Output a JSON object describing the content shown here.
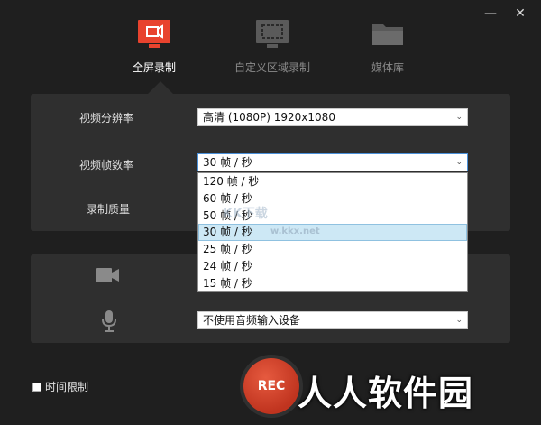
{
  "window": {
    "minimize_icon": "minimize-icon",
    "close_icon": "close-icon",
    "minimize_glyph": "—",
    "close_glyph": "✕"
  },
  "tabs": [
    {
      "label": "全屏录制",
      "icon": "fullscreen-record-icon",
      "active": true
    },
    {
      "label": "自定义区域录制",
      "icon": "region-record-icon",
      "active": false
    },
    {
      "label": "媒体库",
      "icon": "folder-icon",
      "active": false
    }
  ],
  "video": {
    "resolution_label": "视频分辨率",
    "resolution_value": "高清 (1080P)   1920x1080",
    "framerate_label": "视频帧数率",
    "framerate_value": "30 帧 / 秒",
    "quality_label": "录制质量",
    "framerate_options": [
      "120 帧 / 秒",
      "60 帧 / 秒",
      "50 帧 / 秒",
      "30 帧 / 秒",
      "25 帧 / 秒",
      "24 帧 / 秒",
      "15 帧 / 秒"
    ],
    "framerate_selected_index": 3
  },
  "devices": {
    "camera_icon": "camera-icon",
    "mic_icon": "microphone-icon",
    "audio_input_value": "不使用音频输入设备"
  },
  "footer": {
    "time_limit_label": "时间限制",
    "time_limit_checked": false,
    "rec_label": "REC"
  },
  "watermark": {
    "big_text": "人人软件园",
    "small_text": "KK下载",
    "small_url": "w.kkx.net"
  },
  "colors": {
    "accent_red": "#e8432e",
    "background": "#1f1f1f",
    "panel": "#2f2f2f",
    "selected_item": "#cde8f5"
  }
}
